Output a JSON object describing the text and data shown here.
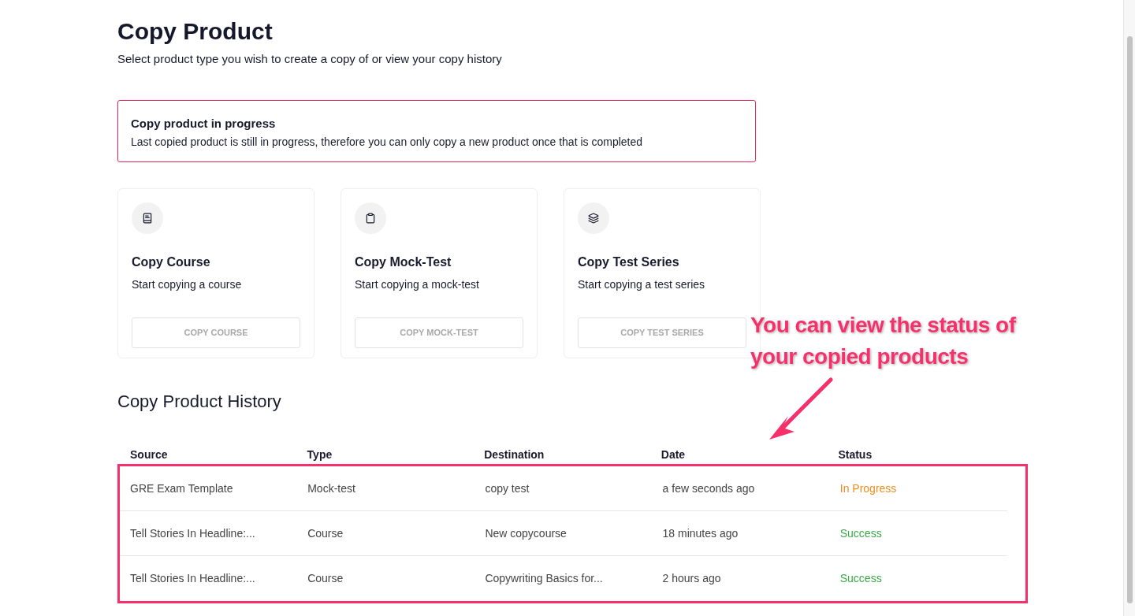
{
  "header": {
    "title": "Copy Product",
    "subtitle": "Select product type you wish to create a copy of or view your copy history"
  },
  "alert": {
    "title": "Copy product in progress",
    "message": "Last copied product is still in progress, therefore you can only copy a new product once that is completed"
  },
  "cards": [
    {
      "title": "Copy Course",
      "description": "Start copying a course",
      "button": "COPY COURSE",
      "disabled": true
    },
    {
      "title": "Copy Mock-Test",
      "description": "Start copying a mock-test",
      "button": "COPY MOCK-TEST",
      "disabled": true
    },
    {
      "title": "Copy Test Series",
      "description": "Start copying a test series",
      "button": "COPY TEST SERIES",
      "disabled": true
    }
  ],
  "annotation": {
    "text": "You can view the status of your copied products"
  },
  "history": {
    "title": "Copy Product History",
    "columns": [
      "Source",
      "Type",
      "Destination",
      "Date",
      "Status"
    ],
    "rows": [
      {
        "cells": [
          "GRE Exam Template",
          "Mock-test",
          "copy test",
          "a few seconds ago"
        ],
        "status": "In Progress",
        "kind": "progress"
      },
      {
        "cells": [
          "Tell Stories In Headline:...",
          "Course",
          "New copycourse",
          "18 minutes ago"
        ],
        "status": "Success",
        "kind": "success"
      },
      {
        "cells": [
          "Tell Stories In Headline:...",
          "Course",
          "Copywriting Basics for...",
          "2 hours ago"
        ],
        "status": "Success",
        "kind": "success"
      }
    ]
  }
}
